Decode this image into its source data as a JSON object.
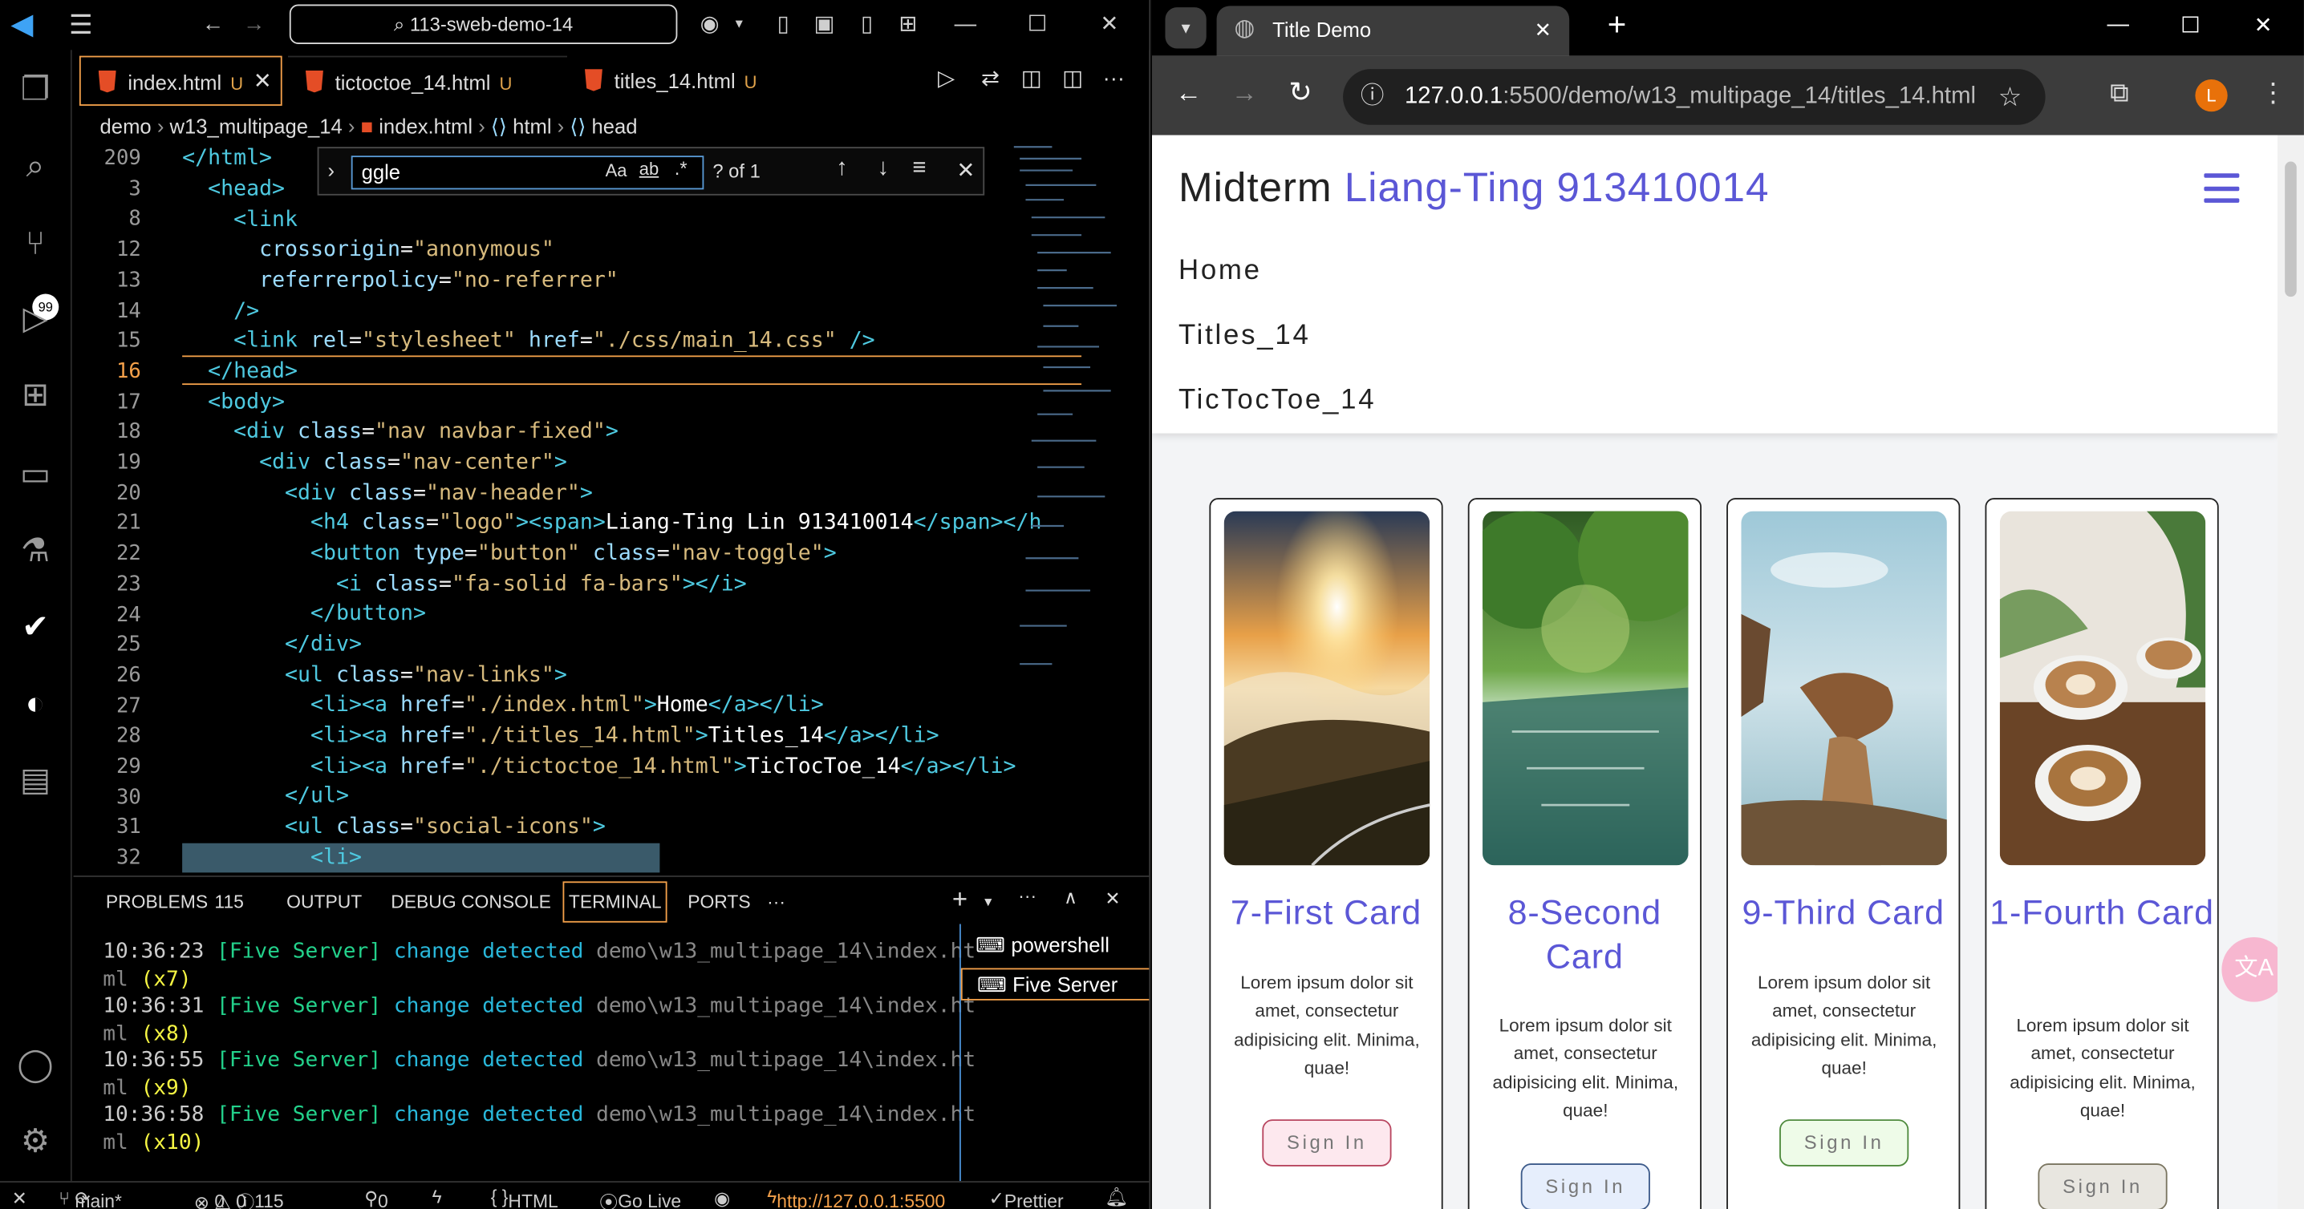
{
  "vscode": {
    "title": "113-sweb-demo-14",
    "tabs": [
      {
        "label": "index.html",
        "flag": "U"
      },
      {
        "label": "tictoctoe_14.html",
        "flag": "U"
      },
      {
        "label": "titles_14.html",
        "flag": "U"
      }
    ],
    "breadcrumb": [
      "demo",
      "w13_multipage_14",
      "index.html",
      "html",
      "head"
    ],
    "find": {
      "query": "ggle",
      "opt_case": "Aa",
      "opt_word": "ab",
      "opt_regex": ".*",
      "count": "? of 1"
    },
    "line_numbers": [
      "209",
      "3",
      "8",
      "12",
      "13",
      "14",
      "15",
      "16",
      "17",
      "18",
      "19",
      "20",
      "21",
      "22",
      "23",
      "24",
      "25",
      "26",
      "27",
      "28",
      "29",
      "30",
      "31",
      "32"
    ],
    "panel": {
      "tabs": [
        "PROBLEMS",
        "115",
        "OUTPUT",
        "DEBUG CONSOLE",
        "TERMINAL",
        "PORTS",
        "···"
      ],
      "terminal_lines": [
        {
          "time": "10:36:23",
          "tag": "[Five Server]",
          "msg": "change detected",
          "path": "demo\\w13_multipage_14\\index.ht",
          "tail": "ml",
          "count": "(x7)"
        },
        {
          "time": "10:36:31",
          "tag": "[Five Server]",
          "msg": "change detected",
          "path": "demo\\w13_multipage_14\\index.ht",
          "tail": "ml",
          "count": "(x8)"
        },
        {
          "time": "10:36:55",
          "tag": "[Five Server]",
          "msg": "change detected",
          "path": "demo\\w13_multipage_14\\index.ht",
          "tail": "ml",
          "count": "(x9)"
        },
        {
          "time": "10:36:58",
          "tag": "[Five Server]",
          "msg": "change detected",
          "path": "demo\\w13_multipage_14\\index.ht",
          "tail": "ml",
          "count": "(x10)"
        }
      ],
      "terminals": [
        "powershell",
        "Five Server"
      ]
    },
    "status": {
      "branch": "main*",
      "errors": "0",
      "warnings": "0",
      "info": "115",
      "ports": "0",
      "lang": "HTML",
      "golive": "Go Live",
      "url": "http://127.0.0.1:5500",
      "prettier": "Prettier",
      "activity_badge": "99"
    }
  },
  "chrome": {
    "tab_title": "Title Demo",
    "url_host": "127.0.0.1",
    "url_rest": ":5500/demo/w13_multipage_14/titles_14.html",
    "profile": "L",
    "site": {
      "logo_prefix": "Midterm",
      "logo_name": "Liang-Ting 913410014",
      "nav": [
        "Home",
        "Titles_14",
        "TicTocToe_14"
      ],
      "cards": [
        {
          "title": "7-First Card",
          "text": "Lorem ipsum dolor sit amet, consectetur adipisicing elit. Minima, quae!",
          "button": "Sign In",
          "btn_bg": "#fde8ee",
          "btn_border": "#b8455f"
        },
        {
          "title": "8-Second Card",
          "text": "Lorem ipsum dolor sit amet, consectetur adipisicing elit. Minima, quae!",
          "button": "Sign In",
          "btn_bg": "#e6eefc",
          "btn_border": "#3c5a8a"
        },
        {
          "title": "9-Third Card",
          "text": "Lorem ipsum dolor sit amet, consectetur adipisicing elit. Minima, quae!",
          "button": "Sign In",
          "btn_bg": "#eefbe8",
          "btn_border": "#4e8a3c"
        },
        {
          "title": "1-Fourth Card",
          "text": "Lorem ipsum dolor sit amet, consectetur adipisicing elit. Minima, quae!",
          "button": "Sign In",
          "btn_bg": "#e8e6e0",
          "btn_border": "#7a7560"
        }
      ],
      "accent": "#5b57d6"
    }
  }
}
